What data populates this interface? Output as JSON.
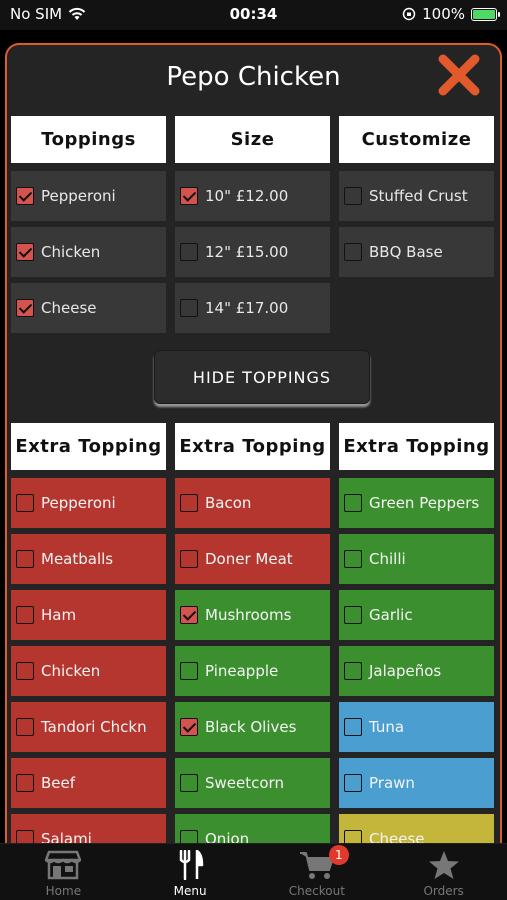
{
  "status_bar": {
    "carrier": "No SIM",
    "time": "00:34",
    "battery": "100%"
  },
  "modal": {
    "title": "Pepo Chicken"
  },
  "headers": [
    "Toppings",
    "Size",
    "Customize"
  ],
  "toppings": [
    {
      "label": "Pepperoni",
      "checked": true
    },
    {
      "label": "Chicken",
      "checked": true
    },
    {
      "label": "Cheese",
      "checked": true
    }
  ],
  "sizes": [
    {
      "label": "10\" £12.00",
      "checked": true
    },
    {
      "label": "12\" £15.00",
      "checked": false
    },
    {
      "label": "14\" £17.00",
      "checked": false
    }
  ],
  "customize": [
    {
      "label": "Stuffed Crust",
      "checked": false
    },
    {
      "label": "BBQ Base",
      "checked": false
    }
  ],
  "hide_toppings_label": "HIDE TOPPINGS",
  "extra_headers": [
    "Extra Topping",
    "Extra Topping",
    "Extra Topping"
  ],
  "extra_col1": [
    {
      "label": "Pepperoni",
      "checked": false,
      "color": "red"
    },
    {
      "label": "Meatballs",
      "checked": false,
      "color": "red"
    },
    {
      "label": "Ham",
      "checked": false,
      "color": "red"
    },
    {
      "label": "Chicken",
      "checked": false,
      "color": "red"
    },
    {
      "label": "Tandori Chckn",
      "checked": false,
      "color": "red"
    },
    {
      "label": "Beef",
      "checked": false,
      "color": "red"
    },
    {
      "label": "Salami",
      "checked": false,
      "color": "red"
    }
  ],
  "extra_col2": [
    {
      "label": "Bacon",
      "checked": false,
      "color": "red"
    },
    {
      "label": "Doner Meat",
      "checked": false,
      "color": "red"
    },
    {
      "label": "Mushrooms",
      "checked": true,
      "color": "green"
    },
    {
      "label": "Pineapple",
      "checked": false,
      "color": "green"
    },
    {
      "label": "Black Olives",
      "checked": true,
      "color": "green"
    },
    {
      "label": "Sweetcorn",
      "checked": false,
      "color": "green"
    },
    {
      "label": "Onion",
      "checked": false,
      "color": "green"
    }
  ],
  "extra_col3": [
    {
      "label": "Green Peppers",
      "checked": false,
      "color": "green"
    },
    {
      "label": "Chilli",
      "checked": false,
      "color": "green"
    },
    {
      "label": "Garlic",
      "checked": false,
      "color": "green"
    },
    {
      "label": "Jalapeños",
      "checked": false,
      "color": "green"
    },
    {
      "label": "Tuna",
      "checked": false,
      "color": "blue"
    },
    {
      "label": "Prawn",
      "checked": false,
      "color": "blue"
    },
    {
      "label": "Cheese",
      "checked": false,
      "color": "yellow"
    }
  ],
  "tabs": [
    {
      "label": "Home",
      "icon": "store-icon"
    },
    {
      "label": "Menu",
      "icon": "cutlery-icon"
    },
    {
      "label": "Checkout",
      "icon": "cart-icon",
      "badge": "1"
    },
    {
      "label": "Orders",
      "icon": "star-icon"
    }
  ],
  "colors": {
    "accent": "#e25a2c",
    "red": "#b5362f",
    "green": "#3c8f2e",
    "blue": "#4a9fd0",
    "yellow": "#c4b63a"
  }
}
